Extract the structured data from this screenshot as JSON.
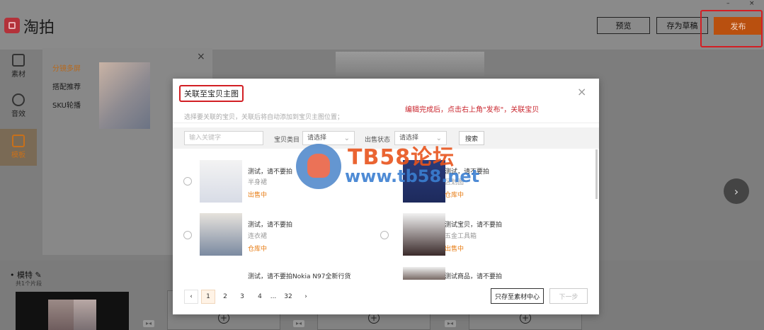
{
  "app": {
    "name": "淘拍"
  },
  "window_controls": [
    "–",
    "×"
  ],
  "header": {
    "preview": "预览",
    "save_draft": "存为草稿",
    "publish": "发布"
  },
  "tools": [
    {
      "label": "素材",
      "icon": "folder-icon"
    },
    {
      "label": "音效",
      "icon": "music-icon"
    },
    {
      "label": "模板",
      "icon": "template-icon",
      "active": true
    }
  ],
  "panel": {
    "items": [
      "分镜多屏",
      "搭配推荐",
      "SKU轮播"
    ],
    "active_index": 0
  },
  "timeline": {
    "title": "模特",
    "subtitle": "共1个片段"
  },
  "modal": {
    "title": "关联至宝贝主图",
    "hint": "选择要关联的宝贝，关联后将自动添加到宝贝主图位置；",
    "annotation": "编辑完成后，点击右上角\"发布\"，关联宝贝",
    "filters": {
      "keyword_placeholder": "输入关键字",
      "category_label": "宝贝类目",
      "category_value": "请选择",
      "status_label": "出售状态",
      "status_value": "请选择",
      "search": "搜索"
    },
    "items": [
      {
        "title": "测试，请不要拍",
        "category": "半身裙",
        "status": "出售中"
      },
      {
        "title": "测试，请不要拍",
        "category": "区划图",
        "status": "仓库中"
      },
      {
        "title": "测试，请不要拍",
        "category": "连衣裙",
        "status": "仓库中"
      },
      {
        "title": "测试宝贝，请不要拍",
        "category": "五金工具箱",
        "status": "出售中"
      },
      {
        "title": "测试，请不要拍Nokia N97全新行货",
        "category": "",
        "status": ""
      },
      {
        "title": "测试商品，请不要拍",
        "category": "",
        "status": ""
      }
    ],
    "pager": {
      "prev": "‹",
      "pages": [
        "1",
        "2",
        "3",
        "4",
        "...",
        "32"
      ],
      "next": "›",
      "current": "1"
    },
    "save_only": "只存至素材中心",
    "next_step": "下一步"
  },
  "watermark": {
    "line1": "TB58论坛",
    "line2": "www.tb58.net"
  },
  "colors": {
    "accent": "#e77b12",
    "publish": "#b9500f",
    "highlight": "#d21f24"
  }
}
